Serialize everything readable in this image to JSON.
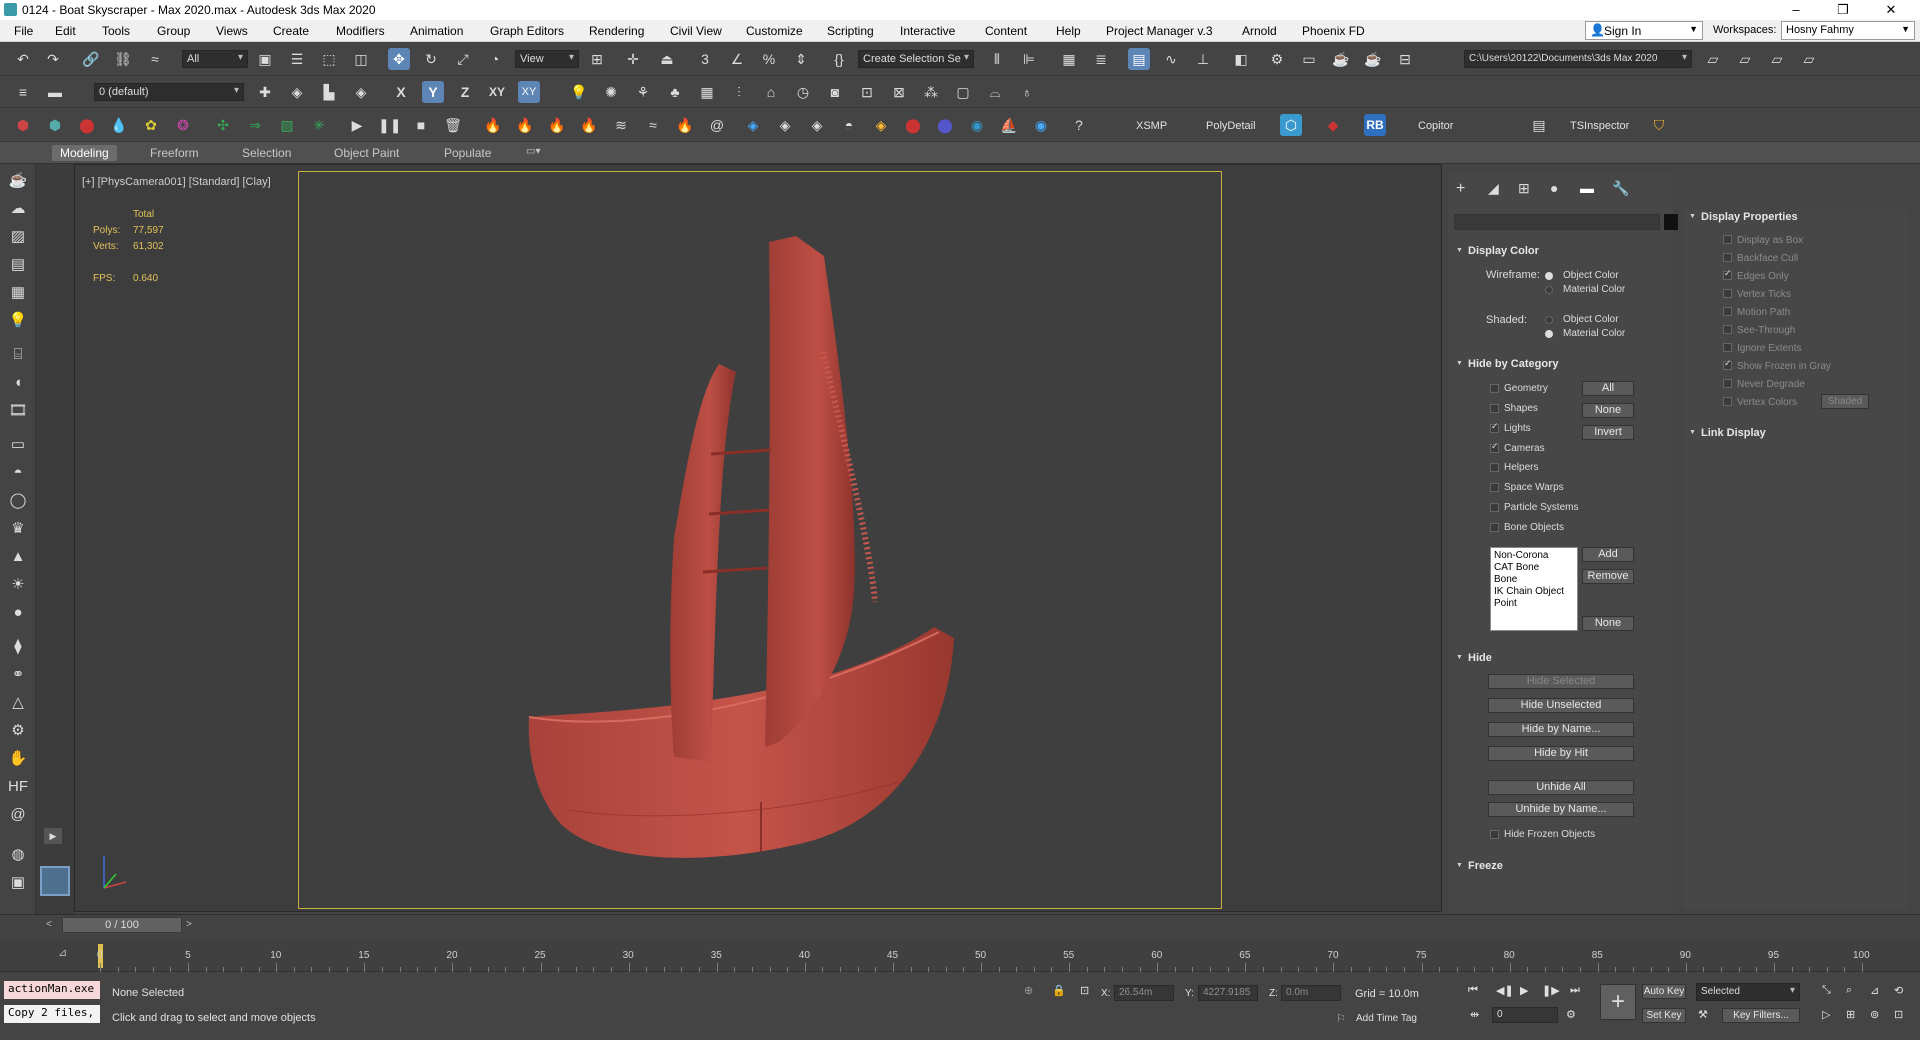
{
  "window": {
    "title": "0124 - Boat Skyscraper - Max 2020.max - Autodesk 3ds Max 2020",
    "controls": [
      "–",
      "❐",
      "✕"
    ]
  },
  "menu": [
    "File",
    "Edit",
    "Tools",
    "Group",
    "Views",
    "Create",
    "Modifiers",
    "Animation",
    "Graph Editors",
    "Rendering",
    "Civil View",
    "Customize",
    "Scripting",
    "Interactive",
    "Content",
    "Help",
    "Project Manager v.3",
    "Arnold",
    "Phoenix FD"
  ],
  "account": {
    "sign_in": "Sign In",
    "workspaces_label": "Workspaces:",
    "workspace": "Hosny Fahmy"
  },
  "toolbar1": {
    "selection_filter": "All",
    "ref_coord": "View",
    "named_selection": "Create Selection Se",
    "project_path": "C:\\Users\\20122\\Documents\\3ds Max 2020"
  },
  "toolbar2": {
    "layer": "0 (default)",
    "axis_x": "X",
    "axis_y": "Y",
    "axis_z": "Z",
    "axis_xy": "XY",
    "axis_xy2": "XY"
  },
  "toolbar3": {
    "xsmp": "XSMP",
    "polydetail": "PolyDetail",
    "rb": "RB",
    "copitor": "Copitor",
    "tsinspector": "TSInspector"
  },
  "ribbon": {
    "tabs": [
      "Modeling",
      "Freeform",
      "Selection",
      "Object Paint",
      "Populate"
    ],
    "active": "Modeling"
  },
  "viewport": {
    "label": "[+] [PhysCamera001] [Standard] [Clay]",
    "stats": {
      "total_label": "Total",
      "polys_label": "Polys:",
      "polys": "77,597",
      "verts_label": "Verts:",
      "verts": "61,302",
      "fps_label": "FPS:",
      "fps": "0.640"
    }
  },
  "command_panel": {
    "display_color": {
      "title": "Display Color",
      "wireframe_label": "Wireframe:",
      "wireframe_options": [
        "Object Color",
        "Material Color"
      ],
      "wireframe_selected": "Object Color",
      "shaded_label": "Shaded:",
      "shaded_options": [
        "Object Color",
        "Material Color"
      ],
      "shaded_selected": "Material Color"
    },
    "hide_by_category": {
      "title": "Hide by Category",
      "items": [
        {
          "label": "Geometry",
          "checked": false
        },
        {
          "label": "Shapes",
          "checked": false
        },
        {
          "label": "Lights",
          "checked": true
        },
        {
          "label": "Cameras",
          "checked": true
        },
        {
          "label": "Helpers",
          "checked": false
        },
        {
          "label": "Space Warps",
          "checked": false
        },
        {
          "label": "Particle Systems",
          "checked": false
        },
        {
          "label": "Bone Objects",
          "checked": false
        }
      ],
      "buttons": [
        "All",
        "None",
        "Invert"
      ],
      "list": [
        "Non-Corona",
        "CAT Bone",
        "Bone",
        "IK Chain Object",
        "Point"
      ],
      "list_buttons": [
        "Add",
        "Remove",
        "None"
      ]
    },
    "hide": {
      "title": "Hide",
      "buttons": [
        "Hide Selected",
        "Hide Unselected",
        "Hide by Name...",
        "Hide by Hit",
        "Unhide All",
        "Unhide by Name..."
      ],
      "hide_frozen": "Hide Frozen Objects"
    },
    "freeze": {
      "title": "Freeze"
    }
  },
  "display_properties": {
    "title": "Display Properties",
    "items": [
      {
        "label": "Display as Box",
        "checked": false
      },
      {
        "label": "Backface Cull",
        "checked": false
      },
      {
        "label": "Edges Only",
        "checked": true
      },
      {
        "label": "Vertex Ticks",
        "checked": false
      },
      {
        "label": "Motion Path",
        "checked": false
      },
      {
        "label": "See-Through",
        "checked": false
      },
      {
        "label": "Ignore Extents",
        "checked": false
      },
      {
        "label": "Show Frozen in Gray",
        "checked": true
      },
      {
        "label": "Never Degrade",
        "checked": false
      },
      {
        "label": "Vertex Colors",
        "checked": false
      }
    ],
    "shaded_button": "Shaded",
    "link_display": "Link Display"
  },
  "timeline": {
    "frame": "0 / 100",
    "ticks": [
      "0",
      "5",
      "10",
      "15",
      "20",
      "25",
      "30",
      "35",
      "40",
      "45",
      "50",
      "55",
      "60",
      "65",
      "70",
      "75",
      "80",
      "85",
      "90",
      "95",
      "100"
    ]
  },
  "status": {
    "maxscript_top": "actionMan.exe",
    "maxscript_bottom": "Copy 2 files,",
    "selection": "None Selected",
    "prompt": "Click and drag to select and move objects",
    "x_label": "X:",
    "x": "26.54m",
    "y_label": "Y:",
    "y": "4227.9185",
    "z_label": "Z:",
    "z": "0.0m",
    "grid": "Grid = 10.0m",
    "add_time_tag": "Add Time Tag",
    "auto_key": "Auto Key",
    "set_key": "Set Key",
    "selected": "Selected",
    "key_filters": "Key Filters...",
    "frame": "0"
  },
  "colors": {
    "model": "#b64a40",
    "safe_frame": "#c9b040",
    "accent": "#5d86b6"
  }
}
